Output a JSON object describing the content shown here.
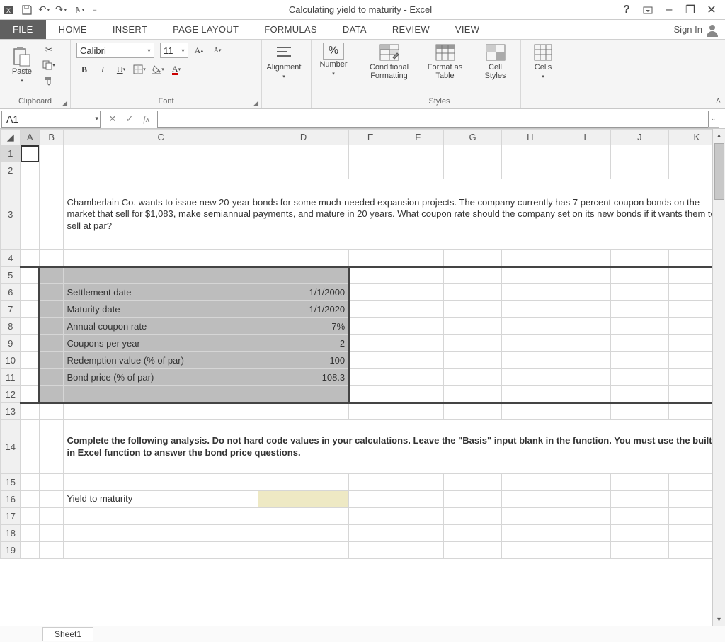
{
  "titlebar": {
    "app_icon": "X▦",
    "title": "Calculating yield to maturity - Excel",
    "help": "?",
    "fullscreen": "▣",
    "minimize": "–",
    "restore": "❐",
    "close": "✕"
  },
  "tabs": {
    "file": "FILE",
    "home": "HOME",
    "insert": "INSERT",
    "page_layout": "PAGE LAYOUT",
    "formulas": "FORMULAS",
    "data": "DATA",
    "review": "REVIEW",
    "view": "VIEW",
    "signin": "Sign In"
  },
  "ribbon": {
    "clipboard": {
      "paste": "Paste",
      "label": "Clipboard"
    },
    "font": {
      "name": "Calibri",
      "size": "11",
      "label": "Font",
      "bold": "B",
      "italic": "I",
      "underline": "U"
    },
    "alignment": {
      "label": "Alignment"
    },
    "number": {
      "label": "Number",
      "percent": "%"
    },
    "styles": {
      "cond_fmt": "Conditional\nFormatting",
      "fmt_table": "Format as\nTable",
      "cell_styles": "Cell\nStyles",
      "label": "Styles"
    },
    "cells": {
      "label": "Cells"
    }
  },
  "namebox": "A1",
  "columns": [
    "A",
    "B",
    "C",
    "D",
    "E",
    "F",
    "G",
    "H",
    "I",
    "J",
    "K"
  ],
  "rows": [
    "1",
    "2",
    "3",
    "4",
    "5",
    "6",
    "7",
    "8",
    "9",
    "10",
    "11",
    "12",
    "13",
    "14",
    "15",
    "16",
    "17",
    "18",
    "19"
  ],
  "problem_text": "Chamberlain Co. wants to issue new 20-year bonds for some much-needed expansion projects. The company currently has 7 percent coupon bonds on the market that sell for $1,083, make semiannual payments, and mature in 20 years. What coupon rate should the company set on its new bonds if it wants them to sell at par?",
  "inputs": {
    "settlement_label": "Settlement date",
    "settlement_val": "1/1/2000",
    "maturity_label": "Maturity date",
    "maturity_val": "1/1/2020",
    "coupon_label": "Annual coupon rate",
    "coupon_val": "7%",
    "freq_label": "Coupons per year",
    "freq_val": "2",
    "redemption_label": "Redemption value (% of par)",
    "redemption_val": "100",
    "price_label": "Bond price (% of par)",
    "price_val": "108.3"
  },
  "instruction_text": "Complete the following analysis. Do not hard code values in your calculations. Leave the \"Basis\" input blank in the function. You must use the built-in Excel function to answer the bond price questions.",
  "ytm_label": "Yield to maturity",
  "sheet_tab": "Sheet1"
}
